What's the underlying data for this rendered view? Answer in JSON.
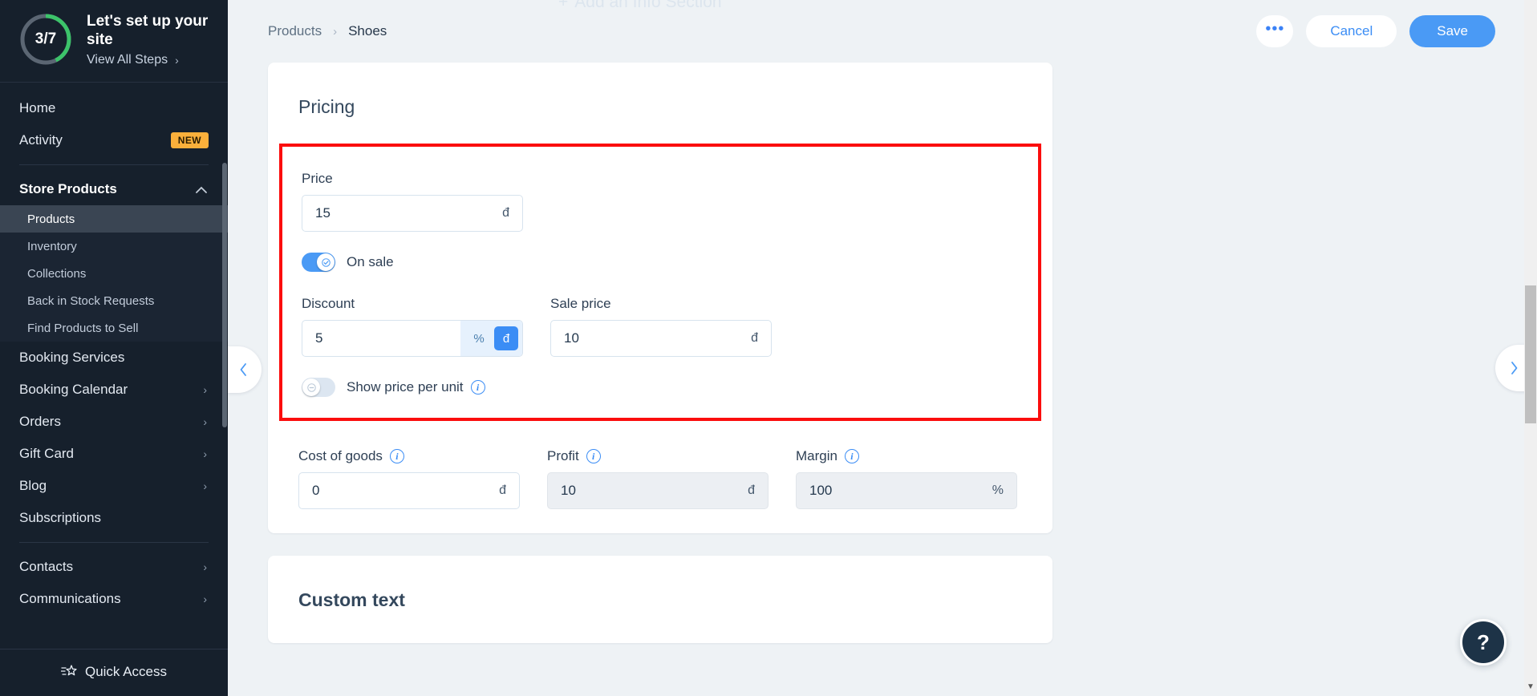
{
  "sidebar": {
    "setup": {
      "progress_label": "3/7",
      "progress_done": 3,
      "progress_total": 7,
      "title": "Let's set up your site",
      "link": "View All Steps",
      "chevron": "chevron-right-icon",
      "ring_done_color": "#3cc36a",
      "ring_track_color": "#5b6673"
    },
    "items": [
      {
        "label": "Home",
        "type": "item",
        "badge": null,
        "arrow": null
      },
      {
        "label": "Activity",
        "type": "item",
        "badge": "NEW",
        "arrow": null
      }
    ],
    "group": {
      "label": "Store Products",
      "collapse_icon": "chevron-up-icon",
      "children": [
        {
          "label": "Products",
          "active": true
        },
        {
          "label": "Inventory",
          "active": false
        },
        {
          "label": "Collections",
          "active": false
        },
        {
          "label": "Back in Stock Requests",
          "active": false
        },
        {
          "label": "Find Products to Sell",
          "active": false
        }
      ]
    },
    "items2": [
      {
        "label": "Booking Services",
        "arrow": null
      },
      {
        "label": "Booking Calendar",
        "arrow": "›"
      },
      {
        "label": "Orders",
        "arrow": "›"
      },
      {
        "label": "Gift Card",
        "arrow": "›"
      },
      {
        "label": "Blog",
        "arrow": "›"
      },
      {
        "label": "Subscriptions",
        "arrow": null
      }
    ],
    "items3": [
      {
        "label": "Contacts",
        "arrow": "›"
      },
      {
        "label": "Communications",
        "arrow": "›"
      }
    ],
    "quick_access": {
      "label": "Quick Access",
      "icon": "shooting-star-icon"
    }
  },
  "header": {
    "ghost_section": {
      "plus": "+",
      "label": "Add an Info Section"
    },
    "breadcrumb": {
      "parent": "Products",
      "separator": "›",
      "current": "Shoes"
    },
    "actions": {
      "more": "•••",
      "more_icon": "ellipsis-icon",
      "cancel": "Cancel",
      "save": "Save",
      "save_color": "#4a9af5"
    }
  },
  "pricing": {
    "title": "Pricing",
    "currency": "đ",
    "percent": "%",
    "price": {
      "label": "Price",
      "value": "15",
      "suffix": "đ"
    },
    "on_sale": {
      "label": "On sale",
      "enabled": true
    },
    "discount": {
      "label": "Discount",
      "value": "5",
      "options": [
        "%",
        "đ"
      ],
      "selected": "đ"
    },
    "sale_price": {
      "label": "Sale price",
      "value": "10",
      "suffix": "đ"
    },
    "show_price_per_unit": {
      "label": "Show price per unit",
      "enabled": false,
      "info": "info-icon"
    },
    "cost_of_goods": {
      "label": "Cost of goods",
      "value": "0",
      "suffix": "đ",
      "disabled": false
    },
    "profit": {
      "label": "Profit",
      "value": "10",
      "suffix": "đ",
      "disabled": true
    },
    "margin": {
      "label": "Margin",
      "value": "100",
      "suffix": "%",
      "disabled": true
    },
    "highlight_color": "#fb0d0d"
  },
  "custom_text": {
    "title": "Custom text"
  },
  "handles": {
    "left": "‹",
    "right": "›"
  },
  "help": {
    "label": "?"
  },
  "scrollbar": {
    "arrow": "▼"
  }
}
